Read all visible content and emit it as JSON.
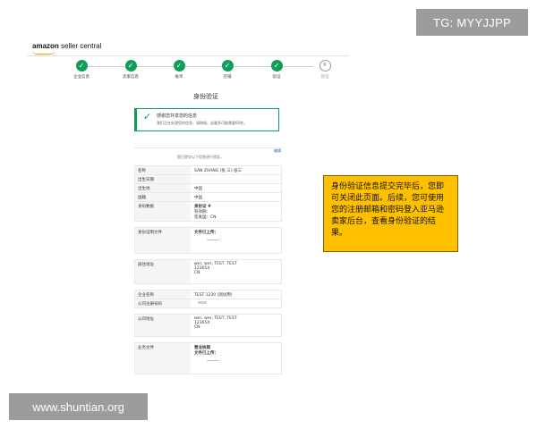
{
  "overlay": {
    "tg_badge": "TG: MYYJJPP",
    "watermark": "www.shuntian.org"
  },
  "header": {
    "logo_brand": "amazon",
    "logo_suffix": " seller central"
  },
  "steps": [
    {
      "label": "企业信息",
      "status": "done",
      "symbol": "✓"
    },
    {
      "label": "卖家信息",
      "status": "done",
      "symbol": "✓"
    },
    {
      "label": "账单",
      "status": "done",
      "symbol": "✓"
    },
    {
      "label": "店铺",
      "status": "done",
      "symbol": "✓"
    },
    {
      "label": "验证",
      "status": "done",
      "symbol": "✓"
    },
    {
      "label": "验证",
      "status": "pending",
      "symbol": "6"
    }
  ],
  "page": {
    "title": "身份验证",
    "success_title": "感谢您共享您的信息",
    "success_body": "我们正在处理您的信息，请稍候。这最多可能需要60秒。",
    "edit_link": "编辑",
    "confirm_text": "您已提交以下信息进行验证。"
  },
  "identity": {
    "rows": [
      {
        "key": "名称",
        "lines": [
          "SAN ZHANG (张 三) 张三",
          "",
          ""
        ]
      },
      {
        "key": "出生日期",
        "lines": [
          ""
        ]
      },
      {
        "key": "出生地",
        "lines": [
          "中国"
        ]
      },
      {
        "key": "国籍",
        "lines": [
          "中国"
        ]
      },
      {
        "key": "身份数据",
        "lines": [
          "身份证 #",
          "有效期：",
          "签发国：CN"
        ]
      }
    ],
    "doc_row": {
      "key": "身份证明文件",
      "lines": [
        "文件已上传："
      ]
    },
    "address_row": {
      "key": "居住地址",
      "lines": [
        "wer, wer, TEST, TEST",
        "123654",
        "CN"
      ]
    },
    "company_rows": [
      {
        "key": "企业名称",
        "lines": [
          "TEST 1230 (测试用)"
        ]
      },
      {
        "key": "公司注册号码",
        "lines": [
          ""
        ]
      }
    ],
    "company_address_row": {
      "key": "公司地址",
      "lines": [
        "wer, wer, TEST, TEST",
        "123654",
        "CN"
      ]
    },
    "business_doc_row": {
      "key": "业务文件",
      "lines": [
        "营业执照",
        "文件已上传："
      ]
    }
  },
  "callout": {
    "text": "身份验证信息提交完毕后，您即可关闭此页面。后续，您可使用您的注册邮箱和密码登入亚马逊卖家后台，查看身份验证的结果。"
  },
  "colors": {
    "step_done": "#0f9d58",
    "callout_bg": "#ffc000",
    "badge_bg": "#9c9c9c"
  }
}
